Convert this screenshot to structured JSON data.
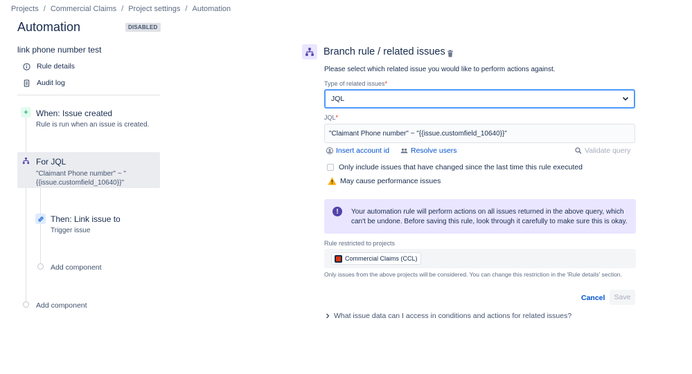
{
  "breadcrumb": {
    "items": [
      "Projects",
      "Commercial Claims",
      "Project settings",
      "Automation"
    ],
    "separator": "/"
  },
  "page": {
    "title": "Automation",
    "status": "DISABLED"
  },
  "sidebar": {
    "rule_name": "link phone number test",
    "links": [
      {
        "label": "Rule details",
        "icon": "info-icon"
      },
      {
        "label": "Audit log",
        "icon": "document-icon"
      }
    ]
  },
  "flow": {
    "trigger": {
      "title": "When: Issue created",
      "subtitle": "Rule is run when an issue is created."
    },
    "branch": {
      "title": "For JQL",
      "subtitle_line1": "\"Claimant Phone number\" ~ \"",
      "subtitle_line2": "{{issue.customfield_10640}}\""
    },
    "action": {
      "title": "Then: Link issue to",
      "subtitle": "Trigger issue"
    },
    "add_component_inner": "Add component",
    "add_component_outer": "Add component"
  },
  "panel": {
    "title": "Branch rule / related issues",
    "description": "Please select which related issue you would like to perform actions against.",
    "type_label": "Type of related issues",
    "type_value": "JQL",
    "jql_label": "JQL",
    "jql_value": "\"Claimant Phone number\" ~ \"{{issue.customfield_10640}}\"",
    "insert_account_id": "Insert account id",
    "resolve_users": "Resolve users",
    "validate_query": "Validate query",
    "checkbox_label": "Only include issues that have changed since the last time this rule executed",
    "warning": "May cause performance issues",
    "info_message": "Your automation rule will perform actions on all issues returned in the above query, which can't be undone. Before saving this rule, look through it carefully to make sure this is okay.",
    "restricted_label": "Rule restricted to projects",
    "project_chip": "Commercial Claims (CCL)",
    "restriction_note": "Only issues from the above projects will be considered. You can change this restriction in the 'Rule details' section.",
    "cancel_label": "Cancel",
    "save_label": "Save",
    "faq": "What issue data can I access in conditions and actions for related issues?",
    "required_mark": "*"
  },
  "colors": {
    "accent": "#0052cc",
    "focus_border": "#4c9aff",
    "info_bg": "#eae6ff",
    "warning": "#ffab00",
    "trigger_green": "#36b37e",
    "branch_purple": "#5243aa"
  }
}
